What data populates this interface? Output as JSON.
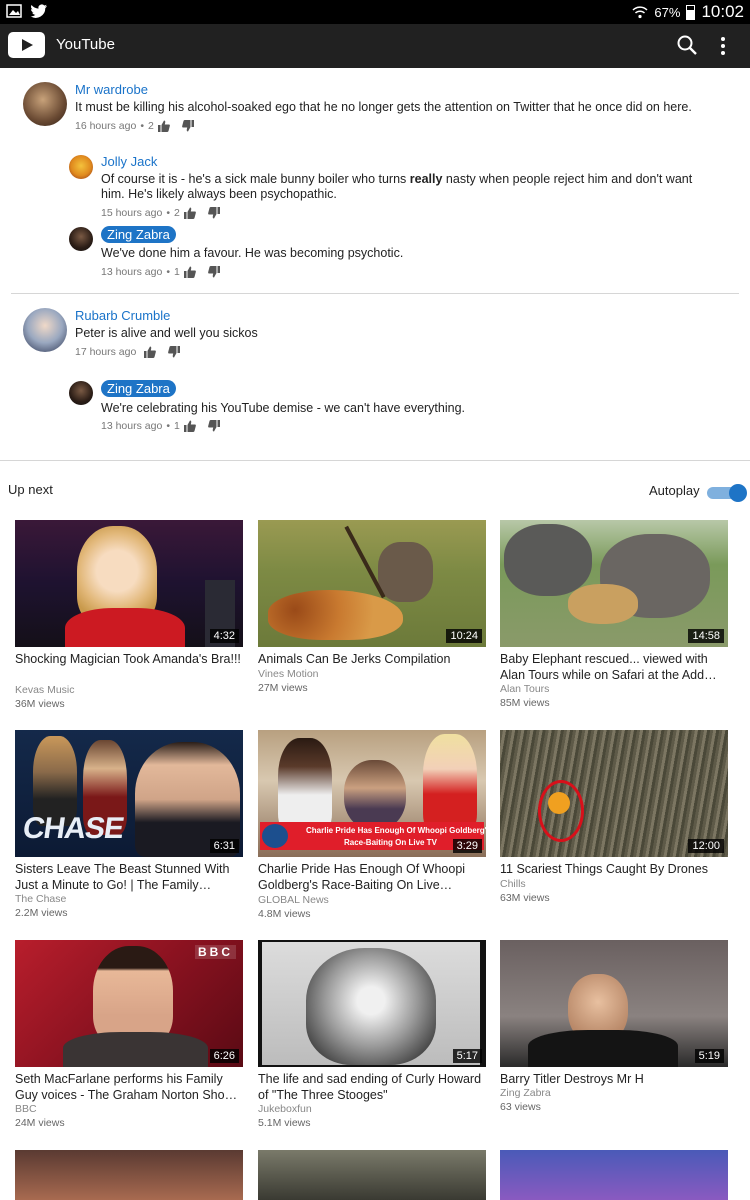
{
  "status_bar": {
    "battery": "67%",
    "time": "10:02",
    "icons": [
      "gallery-icon",
      "twitter-icon",
      "wifi-icon",
      "battery-icon"
    ]
  },
  "app_bar": {
    "title": "YouTube",
    "icons": [
      "youtube-logo",
      "search-icon",
      "more-icon"
    ]
  },
  "comments": [
    {
      "author": "Mr wardrobe",
      "text": "It must be killing his alcohol-soaked ego that he no longer gets the attention on Twitter that he once did on here.",
      "time": "16 hours ago",
      "likes": "2"
    },
    {
      "author": "Jolly Jack",
      "text_before": "Of course it is - he's a sick male bunny boiler who turns ",
      "text_bold": "really",
      "text_after": " nasty when people reject him and don't want him. He's likely always been psychopathic.",
      "time": "15 hours ago",
      "likes": "2"
    },
    {
      "author": "Zing Zabra",
      "text": "We've done him a favour. He was becoming psychotic.",
      "time": "13 hours ago",
      "likes": "1"
    },
    {
      "author": "Rubarb Crumble",
      "text": "Peter is alive and well you sickos",
      "time": "17 hours ago",
      "likes": ""
    },
    {
      "author": "Zing Zabra",
      "text": "We're celebrating his YouTube demise - we can't have everything.",
      "time": "13 hours ago",
      "likes": "1"
    }
  ],
  "meta_separator": "•",
  "up_next": {
    "label": "Up next",
    "autoplay_label": "Autoplay",
    "autoplay_on": true
  },
  "videos": [
    {
      "title": "Shocking Magician Took Amanda's Bra!!!",
      "channel": "Kevas Music",
      "views": "36M views",
      "duration": "4:32"
    },
    {
      "title": "Animals Can Be Jerks Compilation",
      "channel": "Vines Motion",
      "views": "27M views",
      "duration": "10:24"
    },
    {
      "title": "Baby Elephant rescued... viewed with Alan Tours while on Safari at the Add…",
      "channel": "Alan Tours",
      "views": "85M views",
      "duration": "14:58"
    },
    {
      "title": "Sisters Leave The Beast Stunned With Just a Minute to Go! | The Family…",
      "channel": "The Chase",
      "views": "2.2M views",
      "duration": "6:31",
      "thumb_text": "CHASE"
    },
    {
      "title": "Charlie Pride Has Enough Of Whoopi Goldberg's Race-Baiting On Live…",
      "channel": "GLOBAL News",
      "views": "4.8M views",
      "duration": "3:29",
      "thumb_caption_1": "Charlie Pride Has Enough Of Whoopi Goldberg's",
      "thumb_caption_2": "Race-Baiting On Live TV"
    },
    {
      "title": "11 Scariest Things Caught By Drones",
      "channel": "Chills",
      "views": "63M views",
      "duration": "12:00"
    },
    {
      "title": "Seth MacFarlane performs his Family Guy voices - The Graham Norton Sho…",
      "channel": "BBC",
      "views": "24M views",
      "duration": "6:26",
      "thumb_text": "BBC"
    },
    {
      "title": "The life and sad ending of Curly Howard of \"The Three Stooges\"",
      "channel": "Jukeboxfun",
      "views": "5.1M views",
      "duration": "5:17"
    },
    {
      "title": "Barry Titler Destroys Mr H",
      "channel": "Zing Zabra",
      "views": "63 views",
      "duration": "5:19"
    }
  ],
  "colors": {
    "link": "#1a73c9",
    "badge": "#1e74c6",
    "appbar": "#212121",
    "toggle": "#1e74c6"
  }
}
